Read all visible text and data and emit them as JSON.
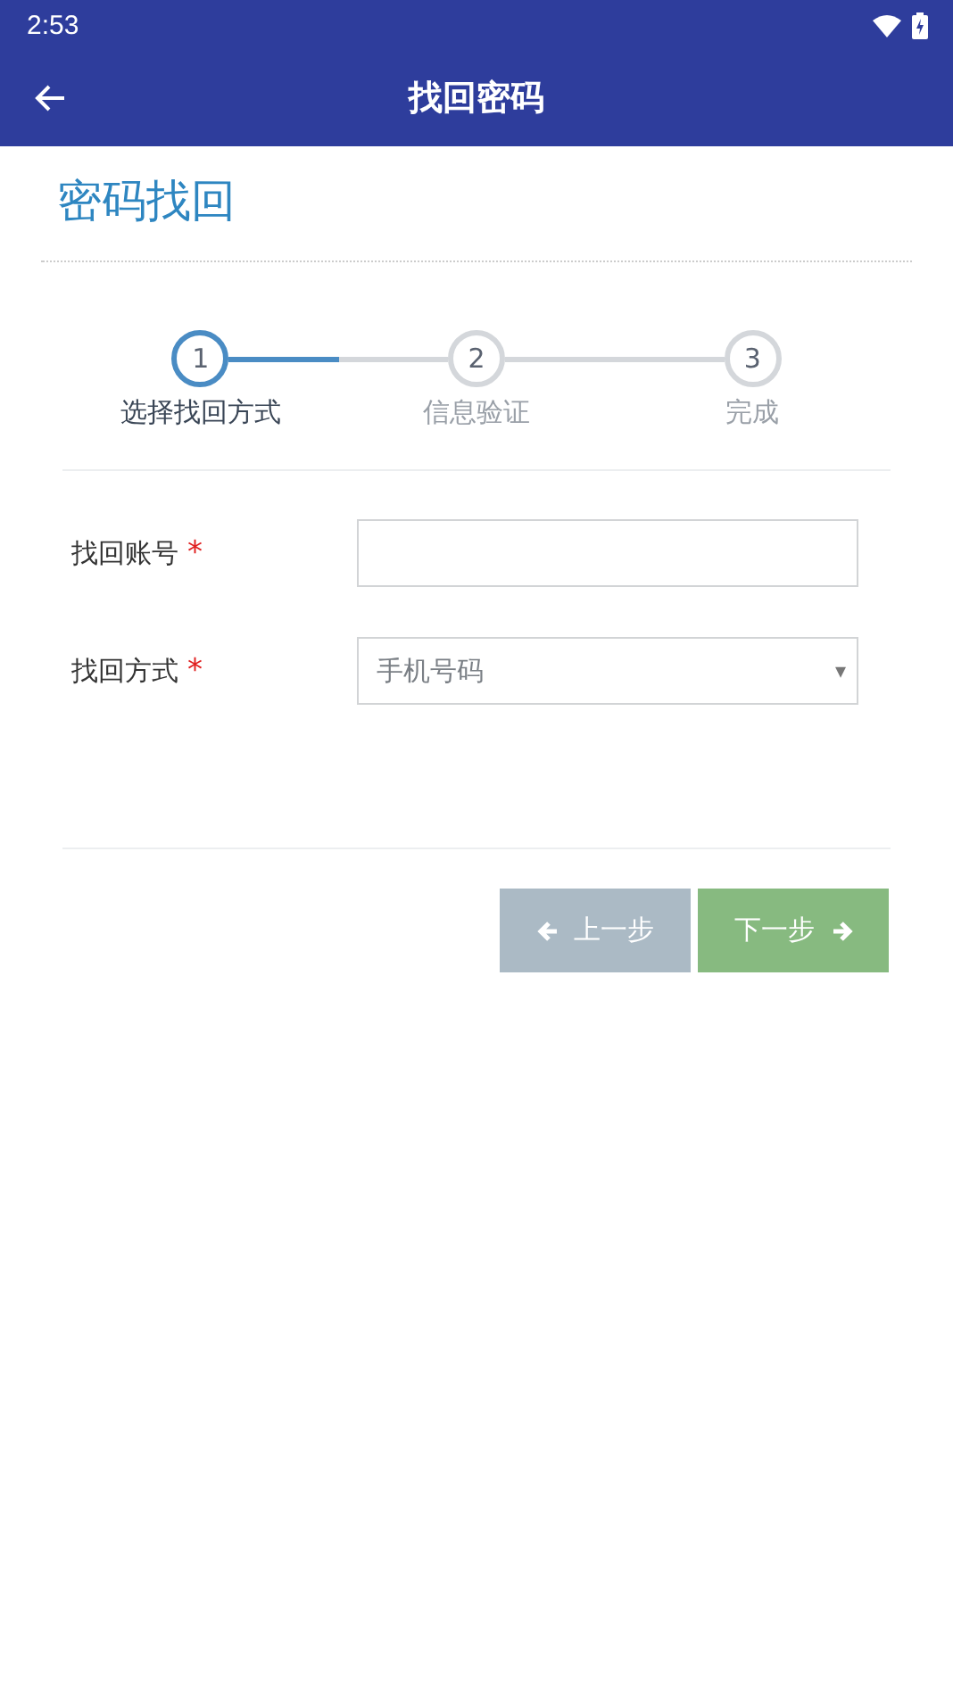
{
  "status_bar": {
    "time": "2:53"
  },
  "app_bar": {
    "title": "找回密码"
  },
  "heading": "密码找回",
  "steps": [
    {
      "number": "1",
      "label": "选择找回方式",
      "selected": true
    },
    {
      "number": "2",
      "label": "信息验证",
      "selected": false
    },
    {
      "number": "3",
      "label": "完成",
      "selected": false
    }
  ],
  "fields": [
    {
      "kind": "text",
      "label": "找回账号",
      "required_mark": "*"
    },
    {
      "kind": "select",
      "label": "找回方式",
      "required_mark": "*",
      "value": "手机号码",
      "arrow": "▾"
    }
  ],
  "buttons": [
    {
      "kind": "prev",
      "label": "上一步"
    },
    {
      "kind": "next",
      "label": "下一步"
    }
  ]
}
